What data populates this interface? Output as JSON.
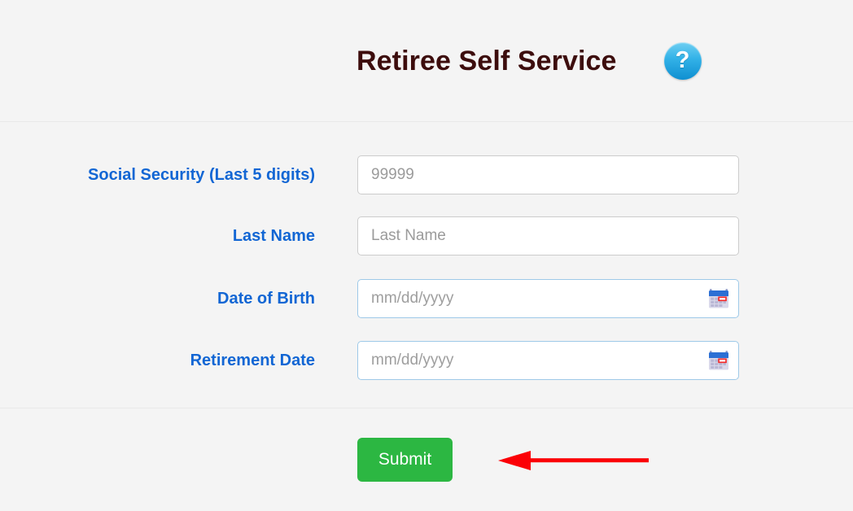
{
  "header": {
    "title": "Retiree Self Service",
    "help_icon": "help-question-icon",
    "help_glyph": "?"
  },
  "form": {
    "fields": [
      {
        "label": "Social Security (Last 5 digits)",
        "name": "social-security-input",
        "placeholder": "99999",
        "value": "",
        "type": "text",
        "has_calendar_icon": false
      },
      {
        "label": "Last Name",
        "name": "last-name-input",
        "placeholder": "Last Name",
        "value": "",
        "type": "text",
        "has_calendar_icon": false
      },
      {
        "label": "Date of Birth",
        "name": "date-of-birth-input",
        "placeholder": "mm/dd/yyyy",
        "value": "",
        "type": "date",
        "has_calendar_icon": true
      },
      {
        "label": "Retirement Date",
        "name": "retirement-date-input",
        "placeholder": "mm/dd/yyyy",
        "value": "",
        "type": "date",
        "has_calendar_icon": true
      }
    ]
  },
  "footer": {
    "submit_label": "Submit"
  },
  "annotation": {
    "arrow": "red-left-arrow",
    "direction": "left"
  },
  "colors": {
    "background": "#f4f4f4",
    "title": "#3d0d0d",
    "label_blue": "#1266d4",
    "submit_green": "#2cb742",
    "date_border_blue": "#9ec9e8",
    "input_border_gray": "#cccccc",
    "placeholder_gray": "#9b9b9b",
    "arrow_red": "#fb0007",
    "divider": "#e9e9e9",
    "help_icon_blue": "#34b3e8"
  }
}
